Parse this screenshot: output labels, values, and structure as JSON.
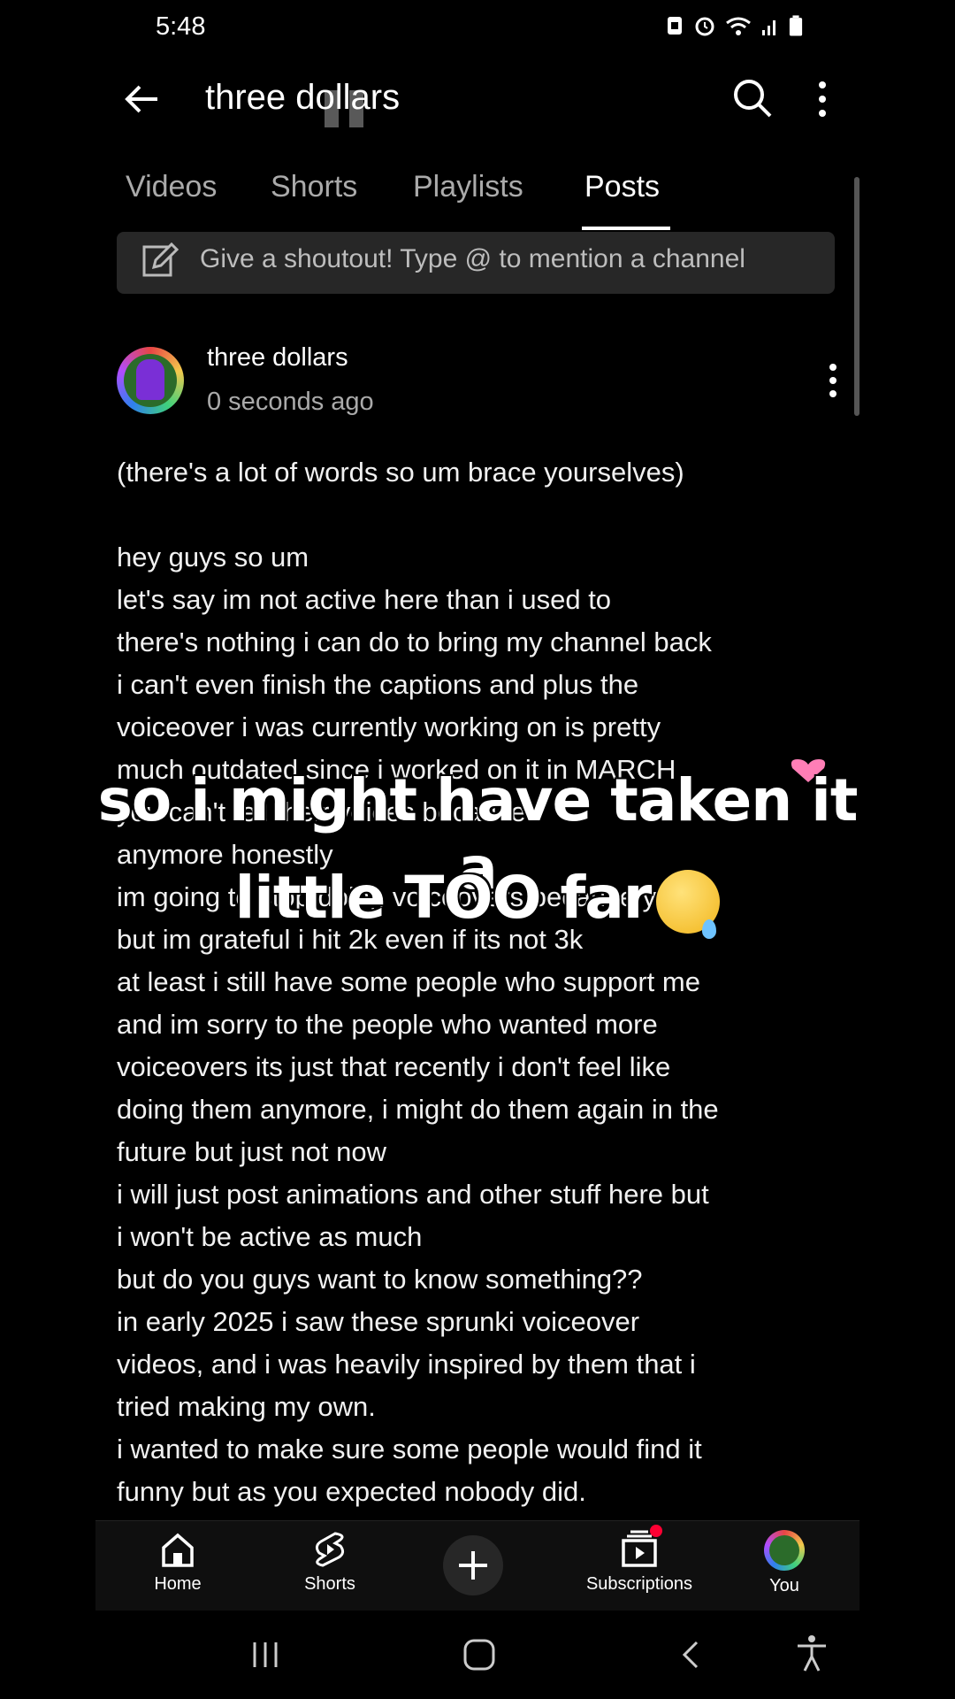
{
  "status_bar": {
    "time": "5:48"
  },
  "header": {
    "title": "three dollars"
  },
  "tabs": [
    {
      "label": "Videos"
    },
    {
      "label": "Shorts"
    },
    {
      "label": "Playlists"
    },
    {
      "label": "Posts"
    }
  ],
  "shoutout": {
    "placeholder": "Give a shoutout! Type @ to mention a channel"
  },
  "post": {
    "channel": "three dollars",
    "time_ago": "0 seconds ago",
    "lines": [
      "(there's a lot of words so um brace yourselves)",
      "",
      "hey guys so um",
      "let's say im not active here than i used to",
      "there's nothing i can do to bring my channel back",
      "i can't even finish the captions and plus the",
      "voiceover i was currently working on is pretty",
      "much outdated since i worked on it in MARCH",
      "you can't tell their voices because",
      "anymore honestly",
      "im going to stop doing voiceovers because yes",
      "but im grateful i hit 2k even if its not 3k",
      "at least i still have some people who support me",
      "and im sorry to the people who wanted more",
      "voiceovers its just that recently i don't feel like",
      "doing them anymore, i might do them again in the",
      "future but just not now",
      "i will just post animations and other stuff here but",
      "i won't be active as much",
      "but do you guys want to know something??",
      "in early 2025 i saw these sprunki voiceover",
      "videos, and i was heavily inspired by them that i",
      "tried making my own.",
      "i wanted to make sure some people would find it",
      "funny but as you expected nobody did."
    ]
  },
  "overlay": {
    "line1": "so i might have taken it a",
    "line2": "little TOO far"
  },
  "bottom_nav": [
    {
      "label": "Home"
    },
    {
      "label": "Shorts"
    },
    {
      "label": "Subscriptions"
    },
    {
      "label": "You"
    }
  ]
}
